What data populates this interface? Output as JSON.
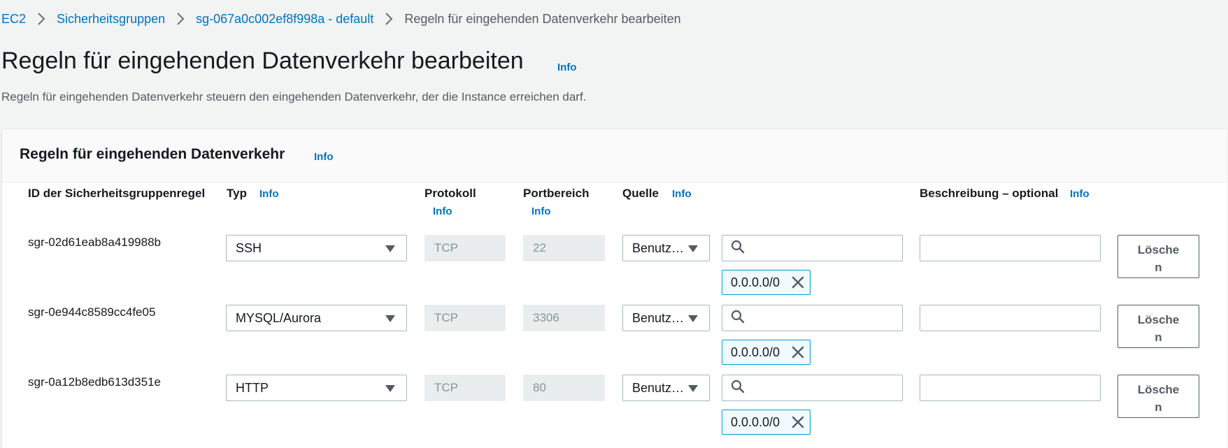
{
  "breadcrumb": {
    "items": [
      "EC2",
      "Sicherheitsgruppen",
      "sg-067a0c002ef8f998a - default"
    ],
    "current": "Regeln für eingehenden Datenverkehr bearbeiten"
  },
  "page": {
    "title": "Regeln für eingehenden Datenverkehr bearbeiten",
    "info": "Info",
    "description": "Regeln für eingehenden Datenverkehr steuern den eingehenden Datenverkehr, der die Instance erreichen darf."
  },
  "panel": {
    "title": "Regeln für eingehenden Datenverkehr",
    "info": "Info",
    "columns": {
      "rule_id": "ID der Sicherheitsgruppenregel",
      "type": "Typ",
      "type_info": "Info",
      "protocol": "Protokoll",
      "protocol_info": "Info",
      "port_range": "Portbereich",
      "port_info": "Info",
      "source": "Quelle",
      "source_info": "Info",
      "description": "Beschreibung – optional",
      "description_info": "Info"
    }
  },
  "rules": [
    {
      "id": "sgr-02d61eab8a419988b",
      "type": "SSH",
      "protocol": "TCP",
      "port": "22",
      "source": "Benutz…",
      "search_value": "",
      "token": "0.0.0.0/0",
      "description": "",
      "delete_label": "Lösche n"
    },
    {
      "id": "sgr-0e944c8589cc4fe05",
      "type": "MYSQL/Aurora",
      "protocol": "TCP",
      "port": "3306",
      "source": "Benutz…",
      "search_value": "",
      "token": "0.0.0.0/0",
      "description": "",
      "delete_label": "Lösche n"
    },
    {
      "id": "sgr-0a12b8edb613d351e",
      "type": "HTTP",
      "protocol": "TCP",
      "port": "80",
      "source": "Benutz…",
      "search_value": "",
      "token": "0.0.0.0/0",
      "description": "",
      "delete_label": "Lösche n"
    }
  ],
  "icons": {
    "breadcrumb_separator": "chevron-right-icon",
    "dropdown": "caret-down-icon",
    "search": "search-icon",
    "remove_token": "close-icon"
  },
  "colors": {
    "link": "#0073bb",
    "token_border": "#00a1c9",
    "token_bg": "#f1faff",
    "page_bg": "#f2f3f3"
  }
}
